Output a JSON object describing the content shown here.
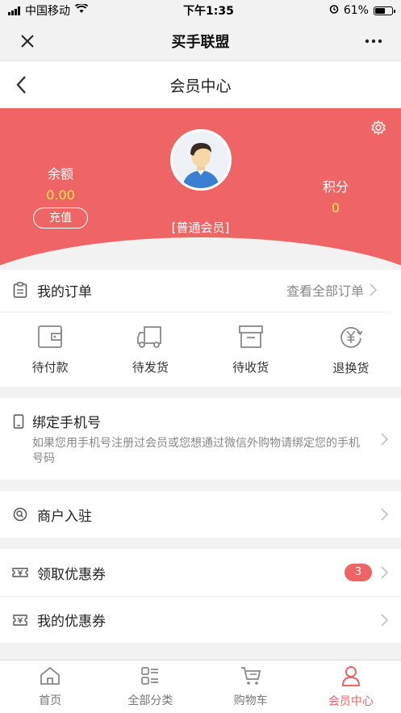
{
  "status_bar": {
    "carrier": "中国移动",
    "time": "下午1:35",
    "battery": "61%"
  },
  "wx_bar": {
    "title": "买手联盟"
  },
  "page": {
    "title": "会员中心"
  },
  "member": {
    "balance_label": "余额",
    "balance_value": "0.00",
    "recharge_label": "充值",
    "points_label": "积分",
    "points_value": "0",
    "level": "[普通会员]"
  },
  "orders": {
    "title": "我的订单",
    "view_all": "查看全部订单",
    "items": [
      {
        "label": "待付款",
        "icon": "wallet-icon"
      },
      {
        "label": "待发货",
        "icon": "truck-icon"
      },
      {
        "label": "待收货",
        "icon": "box-icon"
      },
      {
        "label": "退换货",
        "icon": "yen-refund-icon"
      }
    ]
  },
  "bind_phone": {
    "title": "绑定手机号",
    "desc": "如果您用手机号注册过会员或您想通过微信外购物请绑定您的手机号码"
  },
  "merchant": {
    "title": "商户入驻"
  },
  "coupons": {
    "get_title": "领取优惠券",
    "get_badge": "3",
    "mine_title": "我的优惠券"
  },
  "tabbar": [
    {
      "label": "首页",
      "icon": "home-icon"
    },
    {
      "label": "全部分类",
      "icon": "category-icon"
    },
    {
      "label": "购物车",
      "icon": "cart-icon"
    },
    {
      "label": "会员中心",
      "icon": "user-icon"
    }
  ],
  "colors": {
    "accent": "#ef6565",
    "highlight": "#ffe34d"
  }
}
